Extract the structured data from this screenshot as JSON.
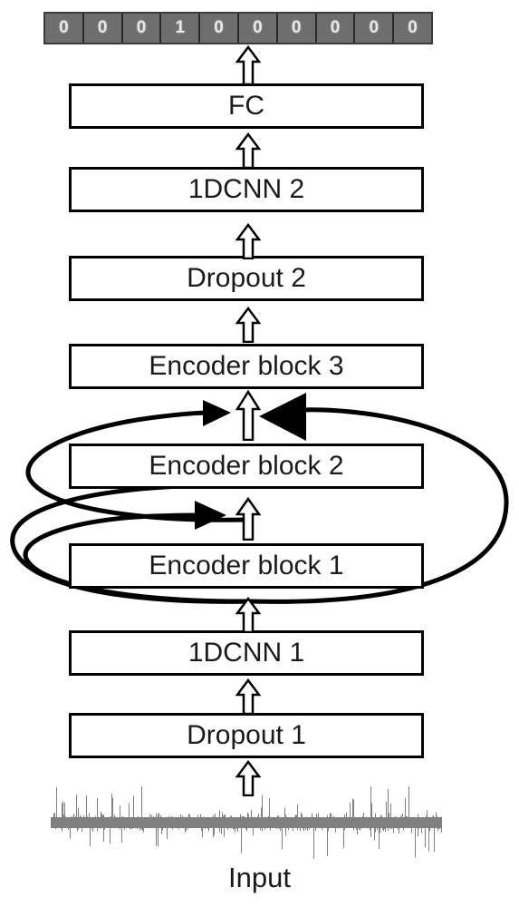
{
  "figure": {
    "type": "neural-network-architecture-diagram",
    "orientation": "bottom-to-top dataflow"
  },
  "output_vector": {
    "name": "one-hot output vector",
    "length": 10,
    "cells": [
      "0",
      "0",
      "0",
      "1",
      "0",
      "0",
      "0",
      "0",
      "0",
      "0"
    ],
    "fill_color": "#6e6e6e",
    "text_color": "#e8e8e8"
  },
  "stages": [
    {
      "id": "fc",
      "label": "FC"
    },
    {
      "id": "cnn2",
      "label": "1DCNN 2"
    },
    {
      "id": "drop2",
      "label": "Dropout 2"
    },
    {
      "id": "enc3",
      "label": "Encoder block 3"
    },
    {
      "id": "enc2",
      "label": "Encoder block 2"
    },
    {
      "id": "enc1",
      "label": "Encoder block 1"
    },
    {
      "id": "cnn1",
      "label": "1DCNN 1"
    },
    {
      "id": "drop1",
      "label": "Dropout 1"
    }
  ],
  "input": {
    "label": "Input",
    "signal_description": "noisy 1-D vibration signal trace",
    "signal_color": "#808080"
  },
  "connections": {
    "flow_arrow_style": "hollow block arrow pointing up",
    "skip_arrow_style": "solid filled triangular arrowhead",
    "skip_connections": [
      {
        "from": "below Encoder block 1",
        "to": "above Encoder block 1"
      },
      {
        "from": "below Encoder block 2",
        "to": "above Encoder block 2"
      }
    ]
  },
  "colors": {
    "outline": "#000000",
    "background": "#ffffff",
    "bar_fill": "#6e6e6e"
  }
}
